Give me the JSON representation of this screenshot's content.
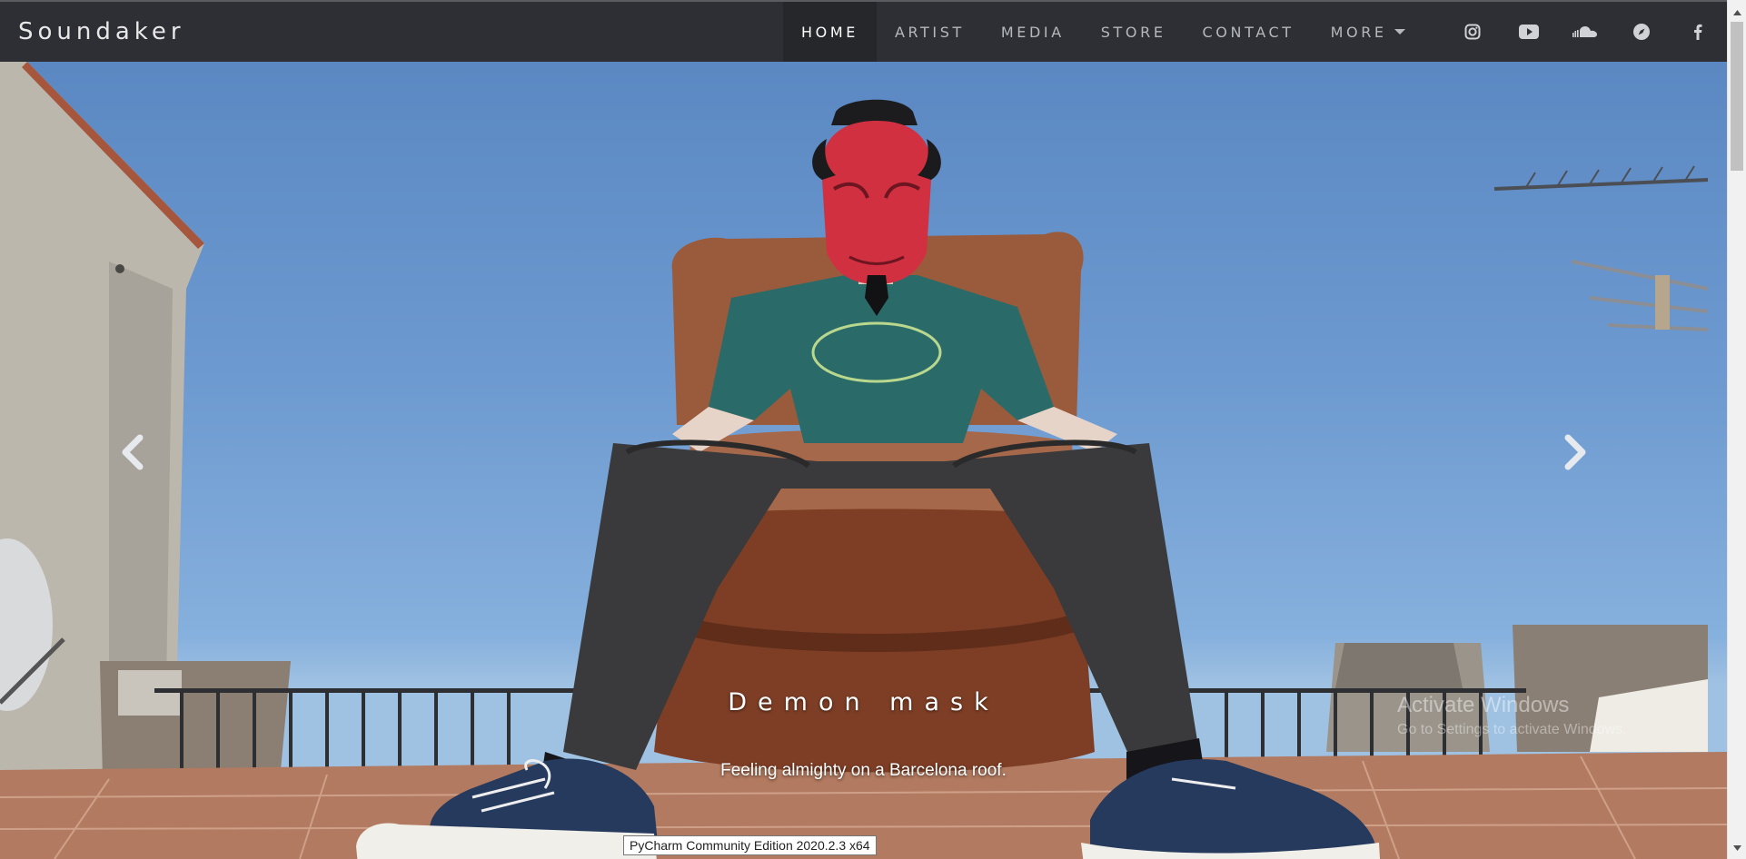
{
  "brand": "Soundaker",
  "nav": {
    "items": [
      {
        "label": "HOME",
        "active": true
      },
      {
        "label": "ARTIST",
        "active": false
      },
      {
        "label": "MEDIA",
        "active": false
      },
      {
        "label": "STORE",
        "active": false
      },
      {
        "label": "CONTACT",
        "active": false
      },
      {
        "label": "MORE",
        "active": false,
        "dropdown": true
      }
    ],
    "social_icons": [
      "instagram-icon",
      "youtube-icon",
      "soundcloud-icon",
      "compass-icon",
      "facebook-icon"
    ]
  },
  "carousel": {
    "caption_title": "Demon mask",
    "caption_text": "Feeling almighty on a Barcelona roof.",
    "prev_icon": "chevron-left-icon",
    "next_icon": "chevron-right-icon"
  },
  "overlay": {
    "watermark_title": "Activate Windows",
    "watermark_sub": "Go to Settings to activate Windows.",
    "tooltip": "PyCharm Community Edition 2020.2.3 x64"
  },
  "colors": {
    "navbar_bg": "#2d2f34",
    "nav_active_bg": "#25272b",
    "sky": "#6d9ad0"
  }
}
